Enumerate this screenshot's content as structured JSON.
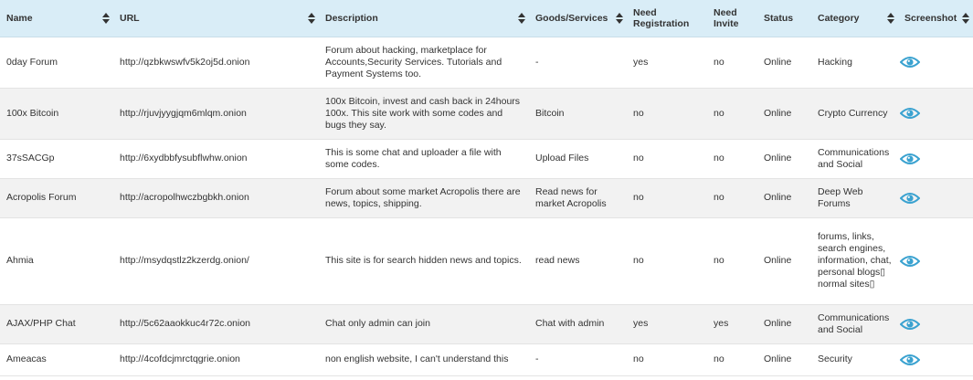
{
  "header": {
    "name": "Name",
    "url": "URL",
    "description": "Description",
    "goods": "Goods/Services",
    "registration": "Need Registration",
    "invite": "Need Invite",
    "status": "Status",
    "category": "Category",
    "screenshot": "Screenshot"
  },
  "colors": {
    "header_bg": "#d9edf7",
    "row_alt_bg": "#f2f2f2",
    "eye_icon": "#3aa2d0"
  },
  "icons": {
    "sort": "sort-arrows-icon",
    "screenshot": "eye-icon"
  },
  "rows": [
    {
      "name": "0day Forum",
      "url": "http://qzbkwswfv5k2oj5d.onion",
      "description": "Forum about hacking, marketplace for Accounts,Security Services. Tutorials and Payment Systems too.",
      "goods": "-",
      "registration": "yes",
      "invite": "no",
      "status": "Online",
      "category": "Hacking"
    },
    {
      "name": "100x Bitcoin",
      "url": "http://rjuvjyygjqm6mlqm.onion",
      "description": "100x Bitcoin, invest and cash back in 24hours 100x. This site work with some codes and bugs they say.",
      "goods": "Bitcoin",
      "registration": "no",
      "invite": "no",
      "status": "Online",
      "category": "Crypto Currency"
    },
    {
      "name": "37sSACGp",
      "url": "http://6xydbbfysubflwhw.onion",
      "description": "This is some chat and uploader a file with some codes.",
      "goods": "Upload Files",
      "registration": "no",
      "invite": "no",
      "status": "Online",
      "category": "Communications and Social"
    },
    {
      "name": "Acropolis Forum",
      "url": "http://acropolhwczbgbkh.onion",
      "description": "Forum about some market Acropolis there are news, topics, shipping.",
      "goods": "Read news for market Acropolis",
      "registration": "no",
      "invite": "no",
      "status": "Online",
      "category": "Deep Web Forums"
    },
    {
      "name": "Ahmia",
      "url": "http://msydqstlz2kzerdg.onion/",
      "description": "This site is for search hidden news and topics.",
      "goods": "read news",
      "registration": "no",
      "invite": "no",
      "status": "Online",
      "category": "forums, links, search engines, information, chat, personal blogs▯ normal sites▯"
    },
    {
      "name": "AJAX/PHP Chat",
      "url": "http://5c62aaokkuc4r72c.onion",
      "description": "Chat only admin can join",
      "goods": "Chat with admin",
      "registration": "yes",
      "invite": "yes",
      "status": "Online",
      "category": "Communications and Social"
    },
    {
      "name": "Ameacas",
      "url": "http://4cofdcjmrctqgrie.onion",
      "description": "non english website, I can't understand this",
      "goods": "-",
      "registration": "no",
      "invite": "no",
      "status": "Online",
      "category": "Security"
    }
  ]
}
